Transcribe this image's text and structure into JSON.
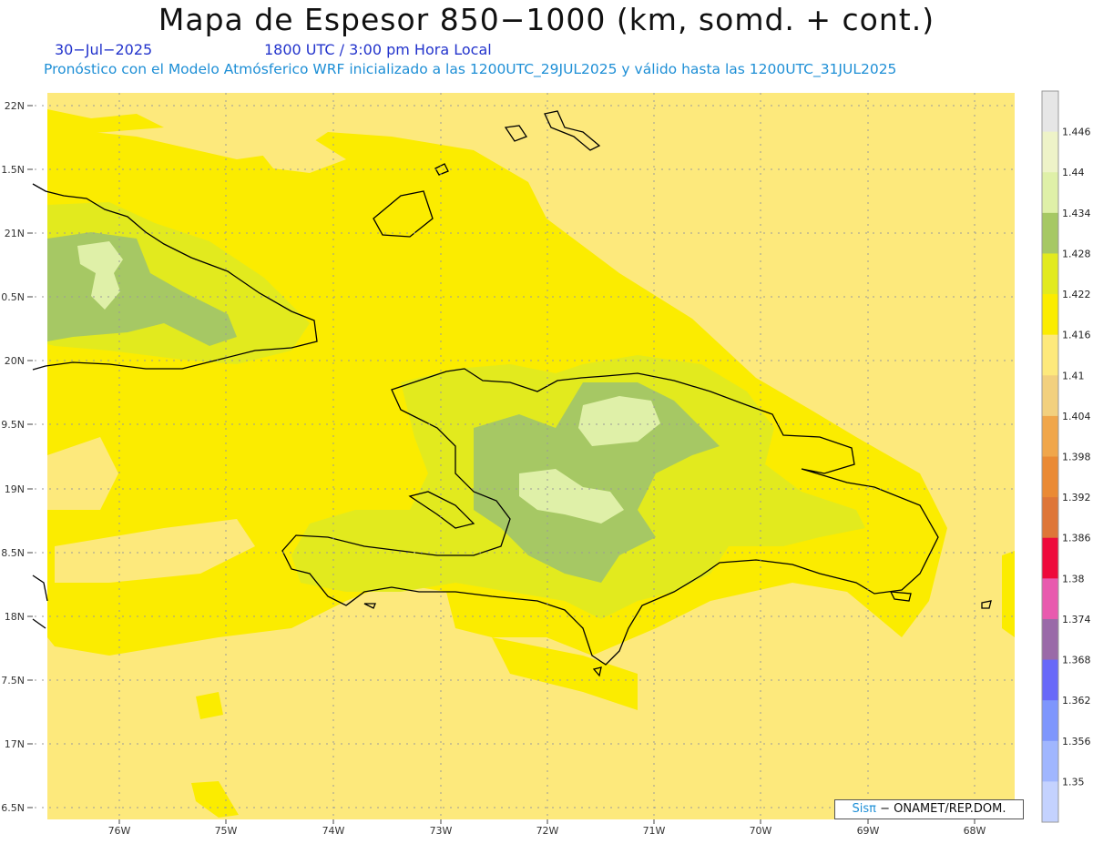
{
  "title": "Mapa de Espesor 850−1000 (km, somd. + cont.)",
  "date": "30−Jul−2025",
  "time": "1800 UTC / 3:00 pm Hora Local",
  "description": "Pronóstico con el Modelo Atmósferico WRF inicializado a las 1200UTC_29JUL2025 y válido hasta las  1200UTC_31JUL2025",
  "credit": {
    "brand": "Sisπ",
    "text": "− ONAMET/REP.DOM."
  },
  "lat_labels": [
    "22N",
    "1.5N",
    "21N",
    "0.5N",
    "20N",
    "9.5N",
    "19N",
    "8.5N",
    "18N",
    "7.5N",
    "17N",
    "6.5N"
  ],
  "lon_labels": [
    "76W",
    "75W",
    "74W",
    "73W",
    "72W",
    "71W",
    "70W",
    "69W",
    "68W"
  ],
  "legend": {
    "labels": [
      "1.446",
      "1.44",
      "1.434",
      "1.428",
      "1.422",
      "1.416",
      "1.41",
      "1.404",
      "1.398",
      "1.392",
      "1.386",
      "1.38",
      "1.374",
      "1.368",
      "1.362",
      "1.356",
      "1.35"
    ],
    "colors": [
      "#e6e6e6",
      "#eef3c8",
      "#dff0a8",
      "#a6c864",
      "#e2ea1e",
      "#fbec00",
      "#fde97c",
      "#f2d07e",
      "#f0a64a",
      "#ea8a34",
      "#de7638",
      "#ee0a3c",
      "#e85aae",
      "#9a6aa8",
      "#6868f8",
      "#7e96fc",
      "#a0b6fe",
      "#c4d2fe"
    ]
  }
}
